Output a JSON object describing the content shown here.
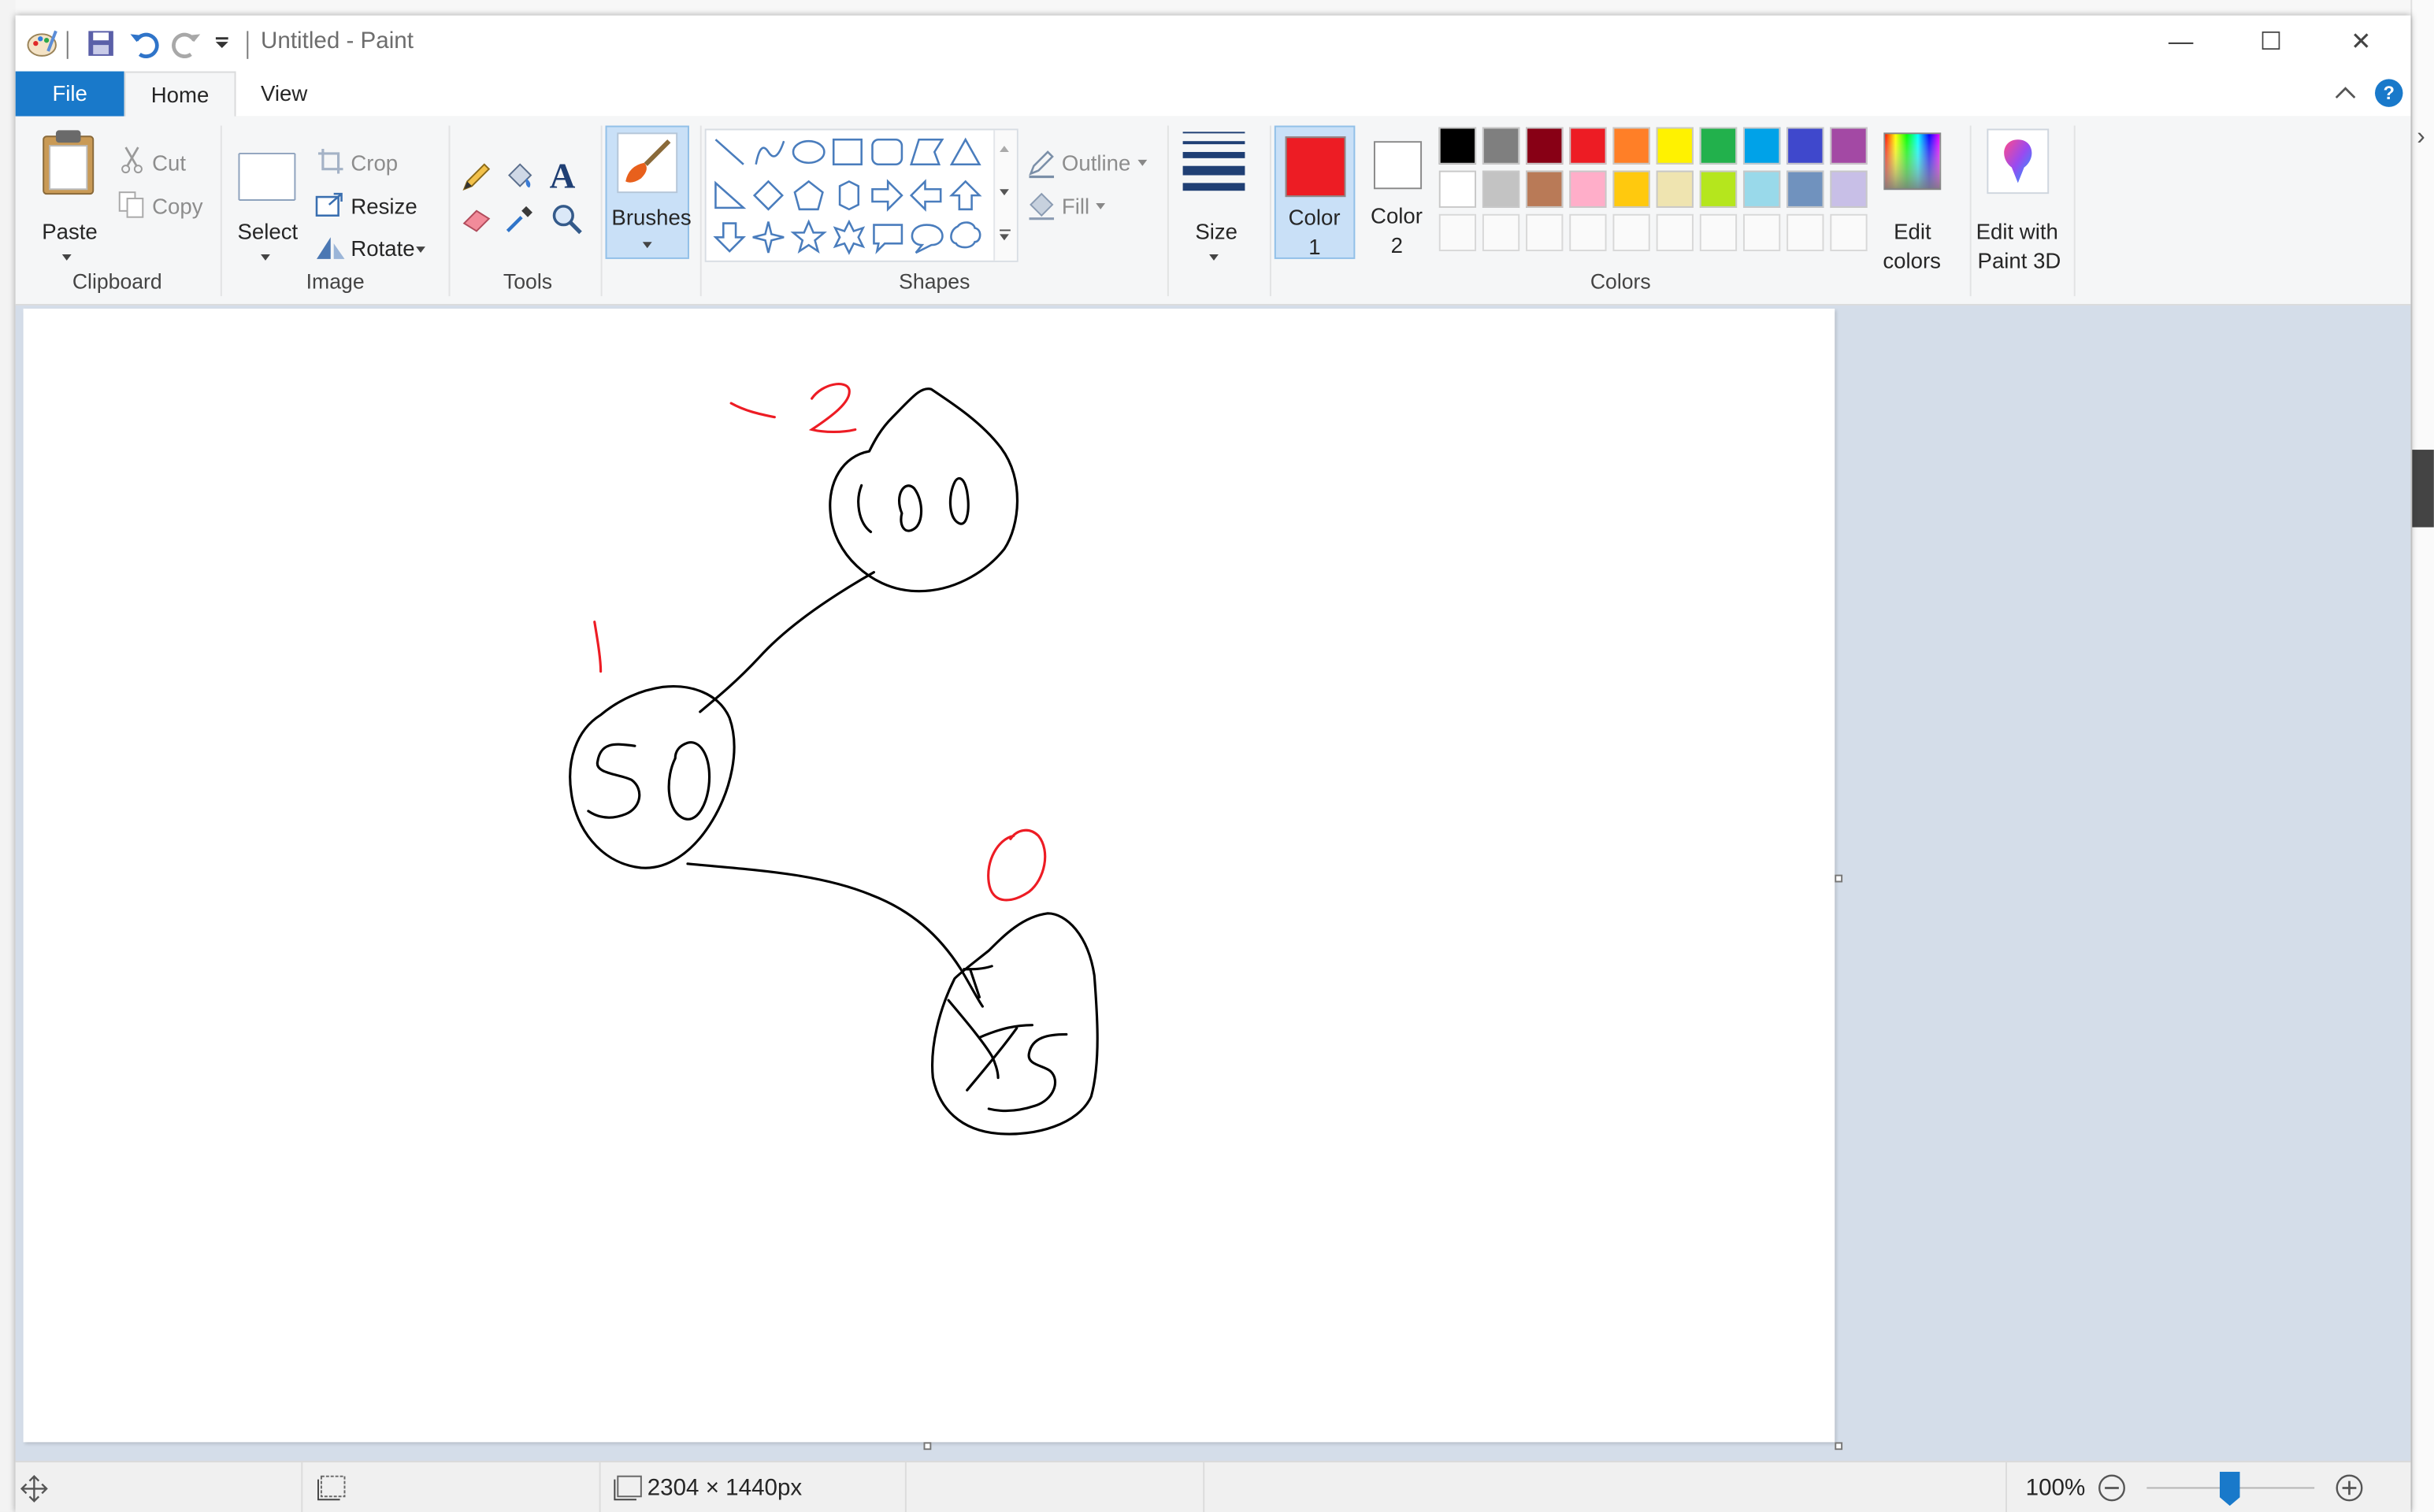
{
  "window": {
    "title": "Untitled - Paint",
    "minimize": "—",
    "maximize": "☐",
    "close": "✕"
  },
  "tabs": {
    "file": "File",
    "home": "Home",
    "view": "View"
  },
  "clipboard": {
    "label": "Clipboard",
    "paste": "Paste",
    "cut": "Cut",
    "copy": "Copy"
  },
  "image": {
    "label": "Image",
    "select": "Select",
    "crop": "Crop",
    "resize": "Resize",
    "rotate": "Rotate"
  },
  "tools": {
    "label": "Tools"
  },
  "brushes": {
    "label": "Brushes"
  },
  "shapes": {
    "label": "Shapes",
    "outline": "Outline",
    "fill": "Fill"
  },
  "size": {
    "label": "Size"
  },
  "colors": {
    "label": "Colors",
    "color1_line1": "Color",
    "color1_line2": "1",
    "color1_value": "#ed1c24",
    "color2_line1": "Color",
    "color2_line2": "2",
    "color2_value": "#ffffff",
    "edit_colors_line1": "Edit",
    "edit_colors_line2": "colors",
    "palette_row1": [
      "#000000",
      "#7f7f7f",
      "#880015",
      "#ed1c24",
      "#ff7f27",
      "#fff200",
      "#22b14c",
      "#00a2e8",
      "#3f48cc",
      "#a349a4"
    ],
    "palette_row2": [
      "#ffffff",
      "#c3c3c3",
      "#b97a57",
      "#ffaec9",
      "#ffc90e",
      "#efe4b0",
      "#b5e61d",
      "#99d9ea",
      "#7092be",
      "#c8bfe7"
    ]
  },
  "paint3d": {
    "line1": "Edit with",
    "line2": "Paint 3D"
  },
  "canvas": {
    "ink": "#000000",
    "accent": "#ed1c24",
    "nodes": [
      "100",
      "50",
      "75"
    ],
    "balance_marks": [
      "-2",
      "1",
      "0"
    ]
  },
  "status": {
    "dimensions": "2304 × 1440px",
    "zoom": "100%"
  }
}
